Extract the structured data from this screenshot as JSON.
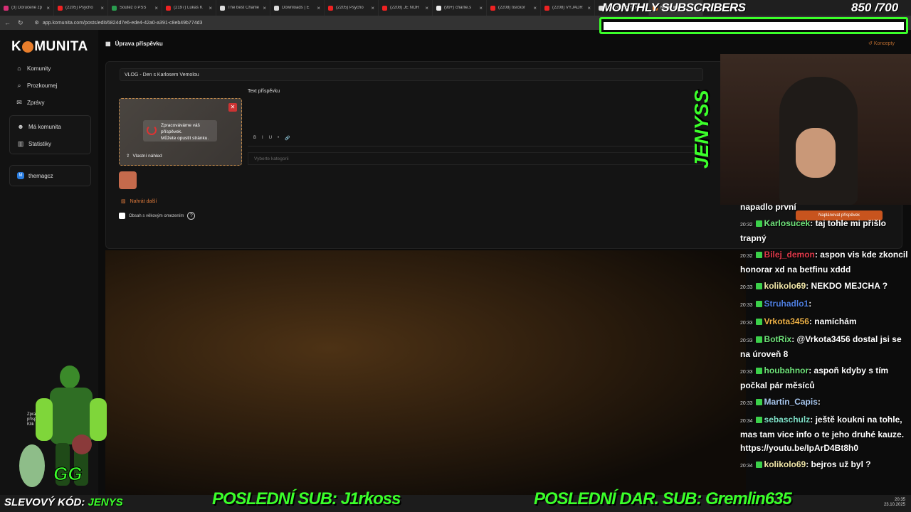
{
  "browser": {
    "tabs": [
      {
        "title": "(3) Doručené zp",
        "color": "#d62f76",
        "active": false
      },
      {
        "title": "(2205) Psycho",
        "color": "#e22",
        "active": false
      },
      {
        "title": "Soutěž o PSS",
        "color": "#2a9d4f",
        "active": false
      },
      {
        "title": "(2197) Lukáš K",
        "color": "#e22",
        "active": false
      },
      {
        "title": "The best Charlie",
        "color": "#ddd",
        "active": false
      },
      {
        "title": "Downloads | E",
        "color": "#ddd",
        "active": false
      },
      {
        "title": "(2205) Psycho",
        "color": "#e22",
        "active": false
      },
      {
        "title": "(2208) JE NOR",
        "color": "#e22",
        "active": false
      },
      {
        "title": "(99+) charlie.s",
        "color": "#eee",
        "active": false
      },
      {
        "title": "(2208) tisíckor",
        "color": "#e22",
        "active": false
      },
      {
        "title": "(2208) VYJÁDŘ",
        "color": "#e22",
        "active": false
      },
      {
        "title": "CHARLIE SRAN",
        "color": "#ddd",
        "active": false
      },
      {
        "title": "Komunita",
        "color": "#e87e2c",
        "active": true
      }
    ],
    "url": "app.komunita.com/posts/edit/6824d7e6-ede4-42a0-a391-c8eb49b774d3"
  },
  "app": {
    "logo_left": "K",
    "logo_right": "MUNITA",
    "nav": [
      {
        "label": "Komunity",
        "icon": "home-icon"
      },
      {
        "label": "Prozkoumej",
        "icon": "search-icon"
      },
      {
        "label": "Zprávy",
        "icon": "mail-icon"
      }
    ],
    "box_nav": [
      {
        "label": "Má komunita",
        "icon": "community-icon"
      },
      {
        "label": "Statistiky",
        "icon": "stats-icon"
      }
    ],
    "community_name": "themagcz",
    "page_title": "Úprava příspěvku",
    "concepts": "Koncepty",
    "post_title": "VLOG - Den s Karlosem Vemolou",
    "processing_line1": "Zpracováváme váš",
    "processing_line2": "příspěvek.",
    "processing_line3": "Můžete opustit stránku.",
    "custom_preview": "Vlastní náhled",
    "text_label": "Text příspěvku",
    "format_buttons": [
      "B",
      "I",
      "U",
      "•",
      "🔗"
    ],
    "category_placeholder": "Vyberte kategorii",
    "upload_more": "Nahrát další",
    "age_restricted": "Obsah s věkovým omezením",
    "schedule": "Naplánovat příspěvek",
    "side_toast_line1": "Zprac",
    "side_toast_line2": "přísp",
    "side_toast_line3": "Klik"
  },
  "overlay": {
    "subs_title": "MONTHLY SUBSCRIBERS",
    "subs_count": "850 /700",
    "brand": "JENYSS",
    "promo_label": "SLEVOVÝ KÓD:",
    "promo_code": "JENYS",
    "last_sub": "POSLEDNÍ SUB: J1rkoss",
    "last_gift": "POSLEDNÍ DAR. SUB: Gremlin635",
    "chat_first": "napadlo první",
    "chat": [
      {
        "time": "20:32",
        "user": "Karlosucek",
        "color": "#6fe27a",
        "text": ": taj tohle mi přišlo trapný"
      },
      {
        "time": "20:32",
        "user": "Bilej_demon",
        "color": "#e0394a",
        "text": ": aspon vis kde zkoncil honorar xd na betfinu xddd"
      },
      {
        "time": "20:33",
        "user": "kolikolo69",
        "color": "#f0e6a8",
        "text": ": NEKDO MEJCHA ?"
      },
      {
        "time": "20:33",
        "user": "Struhadlo1",
        "color": "#4f7fe0",
        "text": ": "
      },
      {
        "time": "20:33",
        "user": "Vrkota3456",
        "color": "#f0b347",
        "text": ": namíchám"
      },
      {
        "time": "20:33",
        "user": "BotRix",
        "color": "#6fe27a",
        "text": ": @Vrkota3456 dostal jsi se na úroveň 8"
      },
      {
        "time": "20:33",
        "user": "houbahnor",
        "color": "#6fe27a",
        "text": ": aspoň kdyby s tím počkal pár měsíců"
      },
      {
        "time": "20:33",
        "user": "Martin_Capis",
        "color": "#a9c8f0",
        "text": ": "
      },
      {
        "time": "20:34",
        "user": "sebaschulz",
        "color": "#7fe0c8",
        "text": ": ještě koukni na tohle, mas tam vice info o te jeho druhé kauze. https://youtu.be/IpArD4Bt8h0"
      },
      {
        "time": "20:34",
        "user": "kolikolo69",
        "color": "#f0e6a8",
        "text": ": bejros už byl ?"
      }
    ]
  },
  "taskbar": {
    "time": "20:35",
    "date": "23.10.2025"
  }
}
